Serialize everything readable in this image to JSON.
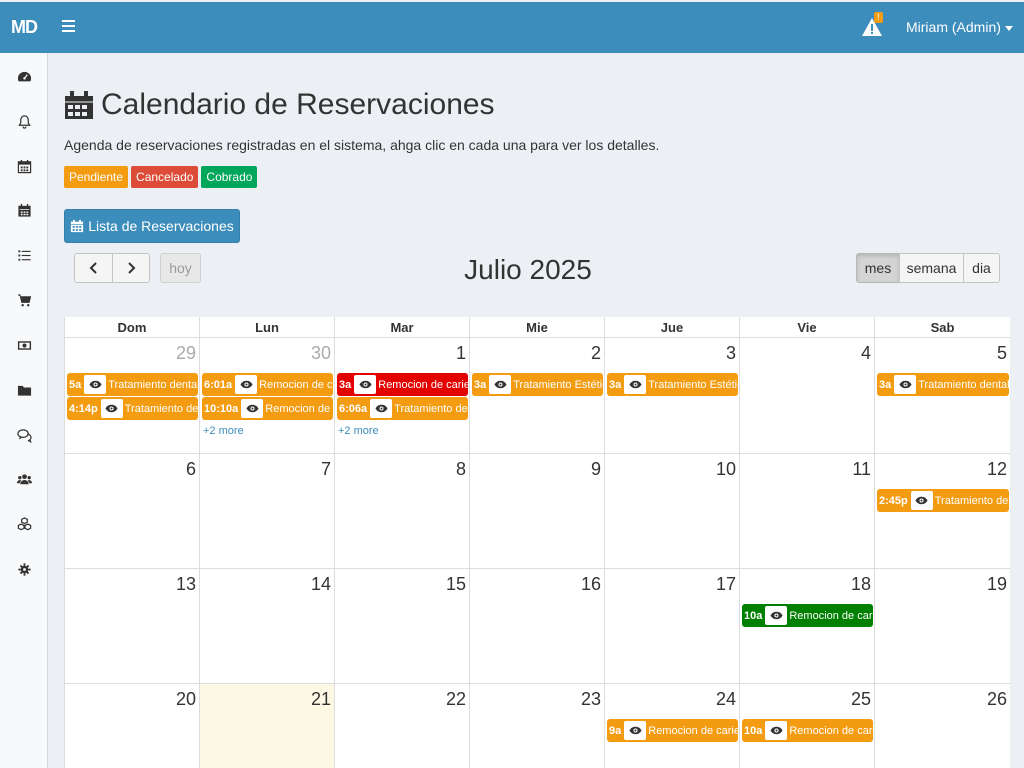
{
  "navbar": {
    "logo": "MD",
    "alert_count": "!",
    "user": "Miriam (Admin)"
  },
  "sidebar": {
    "items": [
      "dashboard-icon",
      "bell-icon",
      "calendar-icon",
      "calendar-dark-icon",
      "list-icon",
      "cart-icon",
      "money-icon",
      "folder-icon",
      "comments-icon",
      "users-icon",
      "cubes-icon",
      "gear-icon"
    ]
  },
  "page": {
    "title": "Calendario de Reservaciones",
    "subtitle": "Agenda de reservaciones registradas en el sistema, ahga clic en cada una para ver los detalles.",
    "legend": [
      {
        "label": "Pendiente",
        "color": "#f39c12"
      },
      {
        "label": "Cancelado",
        "color": "#dd4b39"
      },
      {
        "label": "Cobrado",
        "color": "#00a65a"
      }
    ],
    "list_button": "Lista de Reservaciones"
  },
  "calendar": {
    "title": "Julio 2025",
    "today_label": "hoy",
    "views": [
      "mes",
      "semana",
      "dia"
    ],
    "active_view": "mes",
    "weekdays": [
      "Dom",
      "Lun",
      "Mar",
      "Mie",
      "Jue",
      "Vie",
      "Sab"
    ],
    "weeks": [
      [
        {
          "d": "29",
          "o": true
        },
        {
          "d": "30",
          "o": true
        },
        {
          "d": "1"
        },
        {
          "d": "2"
        },
        {
          "d": "3"
        },
        {
          "d": "4"
        },
        {
          "d": "5"
        }
      ],
      [
        {
          "d": "6"
        },
        {
          "d": "7"
        },
        {
          "d": "8"
        },
        {
          "d": "9"
        },
        {
          "d": "10"
        },
        {
          "d": "11"
        },
        {
          "d": "12"
        }
      ],
      [
        {
          "d": "13"
        },
        {
          "d": "14"
        },
        {
          "d": "15"
        },
        {
          "d": "16"
        },
        {
          "d": "17"
        },
        {
          "d": "18"
        },
        {
          "d": "19"
        }
      ],
      [
        {
          "d": "20"
        },
        {
          "d": "21",
          "today": true
        },
        {
          "d": "22"
        },
        {
          "d": "23"
        },
        {
          "d": "24"
        },
        {
          "d": "25"
        },
        {
          "d": "26"
        }
      ]
    ],
    "events": [
      {
        "w": 0,
        "c": 0,
        "r": 0,
        "time": "5a",
        "name": "Tratamiento dental",
        "color": "#f39c12"
      },
      {
        "w": 0,
        "c": 0,
        "r": 1,
        "time": "4:14p",
        "name": "Tratamiento dental",
        "color": "#f39c12"
      },
      {
        "w": 0,
        "c": 1,
        "r": 0,
        "time": "6:01a",
        "name": "Remocion de caries",
        "color": "#f39c12"
      },
      {
        "w": 0,
        "c": 1,
        "r": 1,
        "time": "10:10a",
        "name": "Remocion de caries",
        "color": "#f39c12"
      },
      {
        "w": 0,
        "c": 2,
        "r": 0,
        "time": "3a",
        "name": "Remocion de caries",
        "color": "#e50000"
      },
      {
        "w": 0,
        "c": 2,
        "r": 1,
        "time": "6:06a",
        "name": "Tratamiento dental",
        "color": "#f39c12"
      },
      {
        "w": 0,
        "c": 3,
        "r": 0,
        "time": "3a",
        "name": "Tratamiento Estético",
        "color": "#f39c12"
      },
      {
        "w": 0,
        "c": 4,
        "r": 0,
        "time": "3a",
        "name": "Tratamiento Estético",
        "color": "#f39c12"
      },
      {
        "w": 0,
        "c": 6,
        "r": 0,
        "time": "3a",
        "name": "Tratamiento dental",
        "color": "#f39c12"
      },
      {
        "w": 1,
        "c": 6,
        "r": 0,
        "time": "2:45p",
        "name": "Tratamiento dental",
        "color": "#f39c12"
      },
      {
        "w": 2,
        "c": 5,
        "r": 0,
        "time": "10a",
        "name": "Remocion de caries",
        "color": "#008000"
      },
      {
        "w": 3,
        "c": 4,
        "r": 0,
        "time": "9a",
        "name": "Remocion de caries",
        "color": "#f39c12"
      },
      {
        "w": 3,
        "c": 5,
        "r": 0,
        "time": "10a",
        "name": "Remocion de caries",
        "color": "#f39c12"
      }
    ],
    "more": [
      {
        "w": 0,
        "c": 1,
        "label": "+2 more"
      },
      {
        "w": 0,
        "c": 2,
        "label": "+2 more"
      }
    ]
  }
}
